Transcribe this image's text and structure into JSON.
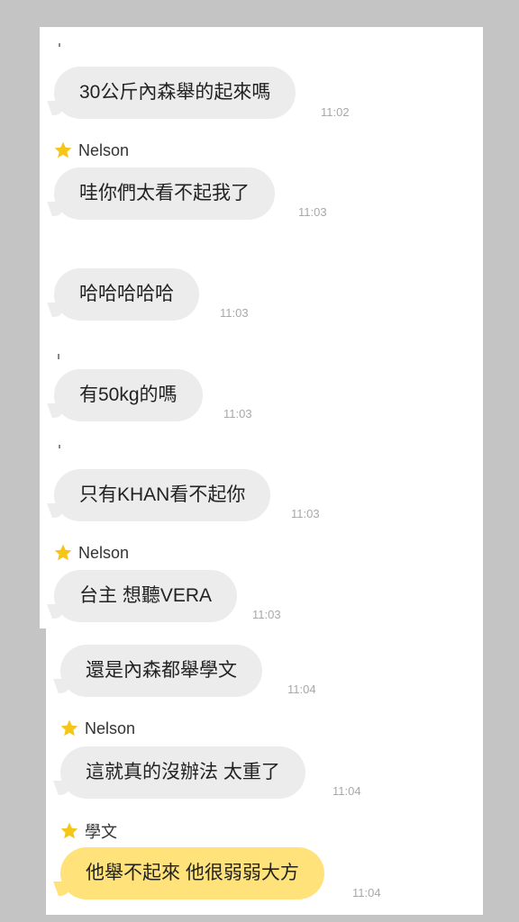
{
  "messages": [
    {
      "sender": "",
      "text": "30公斤內森舉的起來嗎",
      "time": "11:02"
    },
    {
      "sender": "Nelson",
      "text": "哇你們太看不起我了",
      "time": "11:03"
    },
    {
      "sender": "",
      "text": "哈哈哈哈哈",
      "time": "11:03"
    },
    {
      "sender": "",
      "text": "有50kg的嗎",
      "time": "11:03"
    },
    {
      "sender": "",
      "text": "只有KHAN看不起你",
      "time": "11:03"
    },
    {
      "sender": "Nelson",
      "text": "台主 想聽VERA",
      "time": "11:03"
    },
    {
      "sender": "",
      "text": "還是內森都舉學文",
      "time": "11:04"
    },
    {
      "sender": "Nelson",
      "text": "這就真的沒辦法 太重了",
      "time": "11:04"
    },
    {
      "sender": "學文",
      "text": "他舉不起來 他很弱弱大方",
      "time": "11:04",
      "highlight": true
    }
  ],
  "colors": {
    "bubble_gray": "#ececec",
    "bubble_yellow": "#ffe27a",
    "star": "#f5c518",
    "background": "#c4c4c4"
  },
  "icons": {
    "sender_badge": "star-icon"
  }
}
